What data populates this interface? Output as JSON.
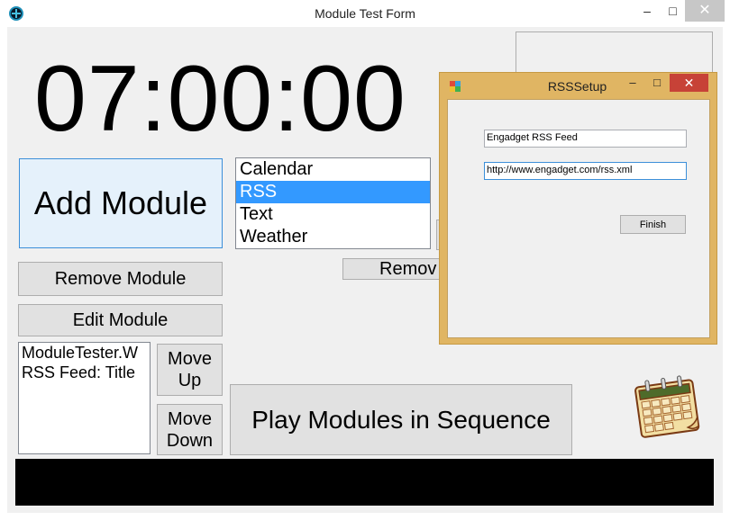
{
  "window": {
    "title": "Module Test Form",
    "controls": {
      "minimize": "–",
      "maximize": "□",
      "close": "✕"
    }
  },
  "clock": {
    "time": "07:00:00"
  },
  "buttons": {
    "add_module": "Add Module",
    "remove_module": "Remove Module",
    "edit_module": "Edit Module",
    "move_up_1": "Move",
    "move_up_2": "Up",
    "move_down_1": "Move",
    "move_down_2": "Down",
    "play_sequence": "Play Modules in Sequence",
    "remove_partial": "Remov"
  },
  "module_list": {
    "items": [
      "Calendar",
      "RSS",
      "Text",
      "Weather"
    ],
    "selected": "RSS"
  },
  "sequence_list": {
    "items": [
      "ModuleTester.W",
      "RSS Feed: Title"
    ]
  },
  "rss_dialog": {
    "title": "RSSSetup",
    "controls": {
      "minimize": "–",
      "maximize": "□",
      "close": "✕"
    },
    "feed_name": "Engadget RSS Feed",
    "feed_url": "http://www.engadget.com/rss.xml",
    "finish_label": "Finish"
  },
  "colors": {
    "selection": "#3399ff",
    "dialog_frame": "#e0b563",
    "dialog_close": "#c74237",
    "bottom_bar": "#000000"
  },
  "icons": [
    "app-icon",
    "calendar-icon",
    "rss-window-icon"
  ]
}
